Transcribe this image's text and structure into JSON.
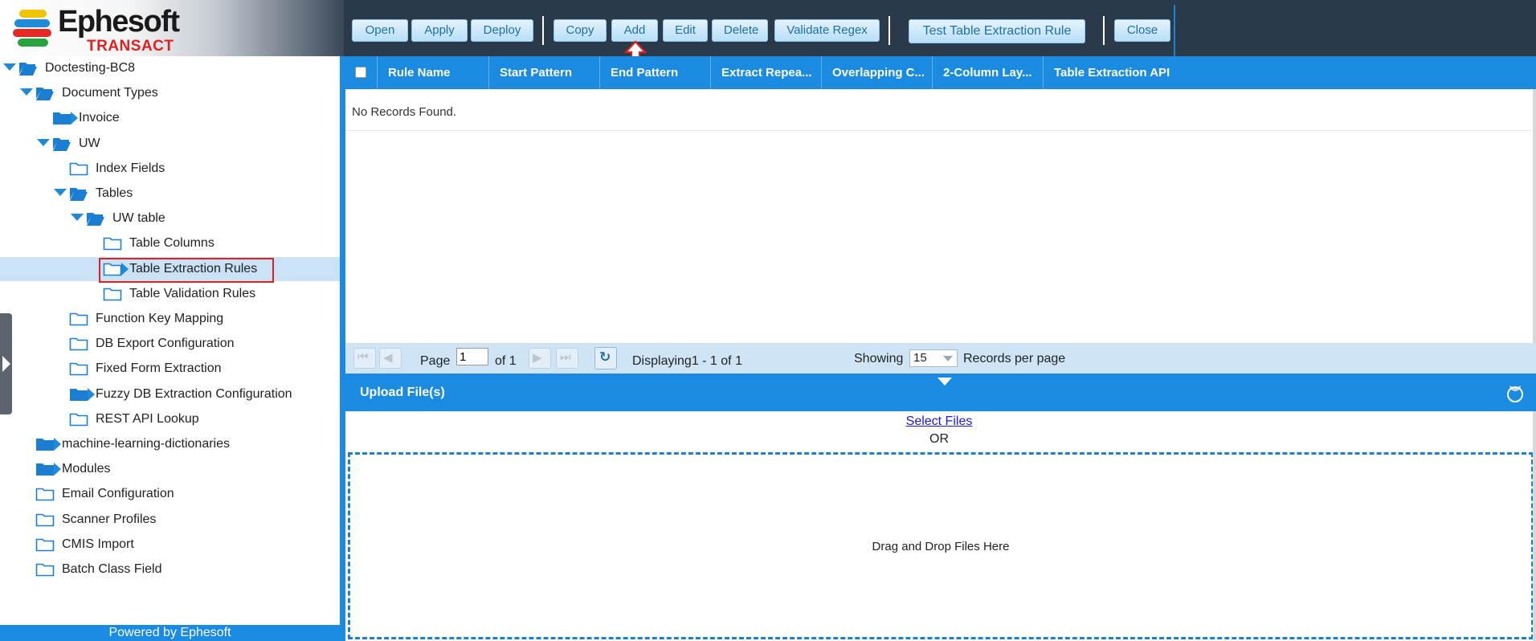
{
  "brand": {
    "name": "Ephesoft",
    "product": "TRANSACT",
    "footer": "Powered by Ephesoft"
  },
  "toolbar": {
    "buttons": [
      "Open",
      "Apply",
      "Deploy",
      "Copy",
      "Add",
      "Edit",
      "Delete",
      "Validate Regex",
      "Test Table Extraction Rule",
      "Close"
    ]
  },
  "tree": {
    "nodes": [
      {
        "label": "Doctesting-BC8",
        "icon": "open-folder-icon",
        "arrow": "down"
      },
      {
        "label": "Document Types",
        "icon": "open-folder-icon",
        "arrow": "down"
      },
      {
        "label": "Invoice",
        "icon": "folder-icon",
        "arrow": "right"
      },
      {
        "label": "UW",
        "icon": "open-folder-icon",
        "arrow": "down"
      },
      {
        "label": "Index Fields",
        "icon": "outline-folder-icon",
        "arrow": "none"
      },
      {
        "label": "Tables",
        "icon": "open-folder-icon",
        "arrow": "down"
      },
      {
        "label": "UW table",
        "icon": "open-folder-icon",
        "arrow": "down"
      },
      {
        "label": "Table Columns",
        "icon": "outline-folder-icon",
        "arrow": "none"
      },
      {
        "label": "Table Extraction Rules",
        "icon": "outline-folder-icon",
        "arrow": "right",
        "selected": true
      },
      {
        "label": "Table Validation Rules",
        "icon": "outline-folder-icon",
        "arrow": "none"
      },
      {
        "label": "Function Key Mapping",
        "icon": "outline-folder-icon",
        "arrow": "none"
      },
      {
        "label": "DB Export Configuration",
        "icon": "outline-folder-icon",
        "arrow": "none"
      },
      {
        "label": "Fixed Form Extraction",
        "icon": "outline-folder-icon",
        "arrow": "none"
      },
      {
        "label": "Fuzzy DB Extraction Configuration",
        "icon": "folder-icon",
        "arrow": "right"
      },
      {
        "label": "REST API Lookup",
        "icon": "outline-folder-icon",
        "arrow": "none"
      },
      {
        "label": "machine-learning-dictionaries",
        "icon": "folder-icon",
        "arrow": "right"
      },
      {
        "label": "Modules",
        "icon": "folder-icon",
        "arrow": "right"
      },
      {
        "label": "Email Configuration",
        "icon": "outline-folder-icon",
        "arrow": "none"
      },
      {
        "label": "Scanner Profiles",
        "icon": "outline-folder-icon",
        "arrow": "none"
      },
      {
        "label": "CMIS Import",
        "icon": "outline-folder-icon",
        "arrow": "none"
      },
      {
        "label": "Batch Class Field",
        "icon": "outline-folder-icon",
        "arrow": "none"
      }
    ]
  },
  "grid": {
    "columns": [
      "Rule Name",
      "Start Pattern",
      "End Pattern",
      "Extract Repea...",
      "Overlapping C...",
      "2-Column Lay...",
      "Table Extraction API"
    ],
    "empty_message": "No Records Found."
  },
  "pager": {
    "page_label": "Page",
    "page_value": "1",
    "of_label": "of 1",
    "displaying": "Displaying1 - 1 of 1",
    "showing_label": "Showing",
    "per_page_value": "15",
    "per_page_label": "Records per page"
  },
  "upload": {
    "title": "Upload File(s)",
    "select_files": "Select Files",
    "or_text": "OR",
    "drop_text": "Drag and Drop Files Here"
  },
  "colors": {
    "accent_blue": "#1a8be0",
    "header_dark": "#2b3a4a",
    "selection": "#c9e2f5",
    "highlight_red": "#e0201c"
  }
}
